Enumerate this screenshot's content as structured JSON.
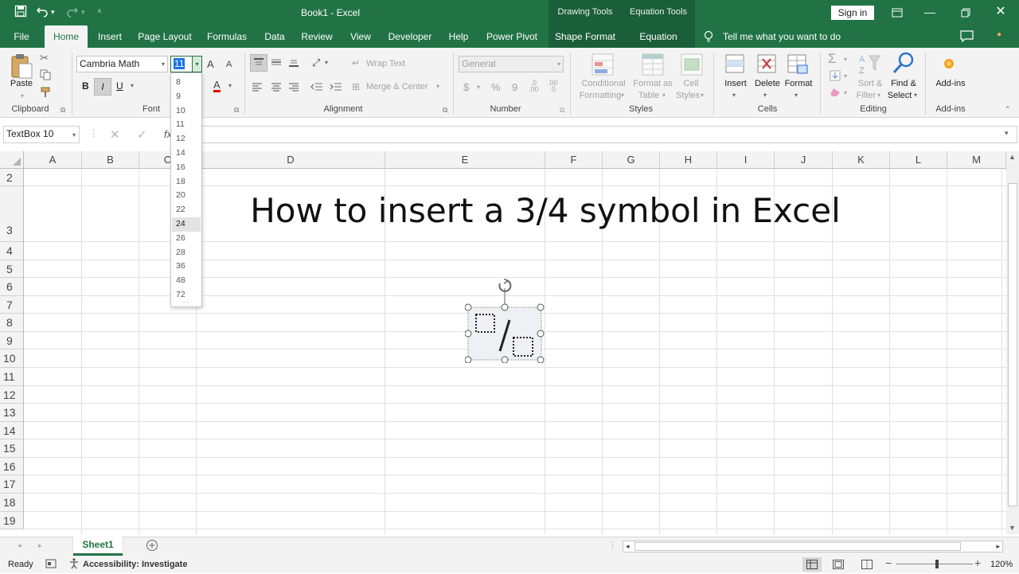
{
  "window": {
    "title": "Book1  -  Excel",
    "sign_in": "Sign in",
    "ctx_drawing": "Drawing Tools",
    "ctx_equation": "Equation Tools"
  },
  "tabs": [
    "File",
    "Home",
    "Insert",
    "Page Layout",
    "Formulas",
    "Data",
    "Review",
    "View",
    "Developer",
    "Help",
    "Power Pivot",
    "Shape Format",
    "Equation"
  ],
  "active_tab": "Home",
  "tell_me": "Tell me what you want to do",
  "ribbon": {
    "clipboard": {
      "label": "Clipboard",
      "paste": "Paste"
    },
    "font": {
      "label": "Font",
      "family": "Cambria Math",
      "size": "11",
      "bold": "B",
      "italic": "I",
      "underline": "U",
      "grow": "A",
      "shrink": "A",
      "fontcolor": "A"
    },
    "alignment": {
      "label": "Alignment",
      "wrap": "Wrap Text",
      "merge": "Merge & Center"
    },
    "number": {
      "label": "Number",
      "format": "General",
      "currency": "$",
      "percent": "%",
      "comma": "9"
    },
    "styles": {
      "label": "Styles",
      "cond1": "Conditional",
      "cond2": "Formatting",
      "fmt1": "Format as",
      "fmt2": "Table",
      "cell1": "Cell",
      "cell2": "Styles"
    },
    "cells": {
      "label": "Cells",
      "insert": "Insert",
      "delete": "Delete",
      "format": "Format"
    },
    "editing": {
      "label": "Editing",
      "sort1": "Sort &",
      "sort2": "Filter",
      "find1": "Find &",
      "find2": "Select"
    },
    "addins": {
      "label": "Add-ins",
      "btn": "Add-ins"
    }
  },
  "name_box": "TextBox 10",
  "font_sizes": [
    "8",
    "9",
    "10",
    "11",
    "12",
    "14",
    "16",
    "18",
    "20",
    "22",
    "24",
    "26",
    "28",
    "36",
    "48",
    "72"
  ],
  "font_size_highlight": "24",
  "columns": [
    "A",
    "B",
    "C",
    "D",
    "E",
    "F",
    "G",
    "H",
    "I",
    "J",
    "K",
    "L",
    "M"
  ],
  "rows": [
    "2",
    "3",
    "4",
    "5",
    "6",
    "7",
    "8",
    "9",
    "10",
    "11",
    "12",
    "13",
    "14",
    "15",
    "16",
    "17",
    "18",
    "19"
  ],
  "heading_text": "How to insert a 3/4 symbol in Excel",
  "sheet_tab": "Sheet1",
  "status": {
    "ready": "Ready",
    "accessibility": "Accessibility: Investigate",
    "zoom": "120%"
  },
  "colors": {
    "brand": "#217346",
    "ribbon": "#f3f3f3"
  }
}
